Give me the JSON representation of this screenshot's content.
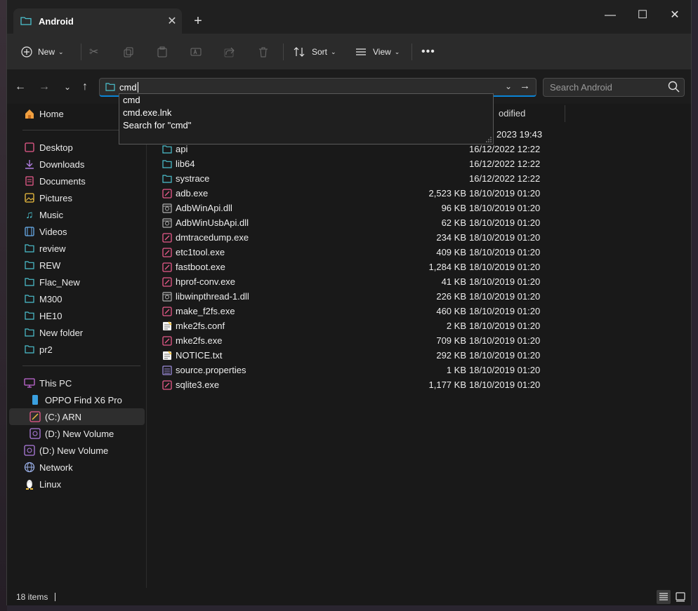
{
  "window": {
    "tab_title": "Android"
  },
  "toolbar": {
    "new_label": "New",
    "sort_label": "Sort",
    "view_label": "View"
  },
  "address": {
    "value": "cmd",
    "search_placeholder": "Search Android"
  },
  "autocomplete": [
    "cmd",
    "cmd.exe.lnk",
    "Search for \"cmd\""
  ],
  "sidebar": {
    "home": "Home",
    "pinned": [
      "Desktop",
      "Downloads",
      "Documents",
      "Pictures",
      "Music",
      "Videos",
      "review",
      "REW",
      "Flac_New"
    ],
    "folders": [
      "M300",
      "HE10",
      "New folder",
      "pr2"
    ],
    "this_pc": "This PC",
    "devices": [
      "OPPO Find X6 Pro",
      "(C:) ARN",
      "(D:) New Volume"
    ],
    "drive_d": "(D:) New Volume",
    "network": "Network",
    "linux": "Linux"
  },
  "filelist": {
    "column_date_partial": "odified",
    "first_row_date_partial": "2023 19:43",
    "rows": [
      {
        "name": "api",
        "size": "",
        "date": "16/12/2022 12:22",
        "type": "folder"
      },
      {
        "name": "lib64",
        "size": "",
        "date": "16/12/2022 12:22",
        "type": "folder"
      },
      {
        "name": "systrace",
        "size": "",
        "date": "16/12/2022 12:22",
        "type": "folder"
      },
      {
        "name": "adb.exe",
        "size": "2,523 KB",
        "date": "18/10/2019 01:20",
        "type": "exe"
      },
      {
        "name": "AdbWinApi.dll",
        "size": "96 KB",
        "date": "18/10/2019 01:20",
        "type": "dll"
      },
      {
        "name": "AdbWinUsbApi.dll",
        "size": "62 KB",
        "date": "18/10/2019 01:20",
        "type": "dll"
      },
      {
        "name": "dmtracedump.exe",
        "size": "234 KB",
        "date": "18/10/2019 01:20",
        "type": "exe"
      },
      {
        "name": "etc1tool.exe",
        "size": "409 KB",
        "date": "18/10/2019 01:20",
        "type": "exe"
      },
      {
        "name": "fastboot.exe",
        "size": "1,284 KB",
        "date": "18/10/2019 01:20",
        "type": "exe"
      },
      {
        "name": "hprof-conv.exe",
        "size": "41 KB",
        "date": "18/10/2019 01:20",
        "type": "exe"
      },
      {
        "name": "libwinpthread-1.dll",
        "size": "226 KB",
        "date": "18/10/2019 01:20",
        "type": "dll"
      },
      {
        "name": "make_f2fs.exe",
        "size": "460 KB",
        "date": "18/10/2019 01:20",
        "type": "exe"
      },
      {
        "name": "mke2fs.conf",
        "size": "2 KB",
        "date": "18/10/2019 01:20",
        "type": "txt"
      },
      {
        "name": "mke2fs.exe",
        "size": "709 KB",
        "date": "18/10/2019 01:20",
        "type": "exe"
      },
      {
        "name": "NOTICE.txt",
        "size": "292 KB",
        "date": "18/10/2019 01:20",
        "type": "txt"
      },
      {
        "name": "source.properties",
        "size": "1 KB",
        "date": "18/10/2019 01:20",
        "type": "props"
      },
      {
        "name": "sqlite3.exe",
        "size": "1,177 KB",
        "date": "18/10/2019 01:20",
        "type": "exe"
      }
    ]
  },
  "status": {
    "item_count": "18 items"
  }
}
